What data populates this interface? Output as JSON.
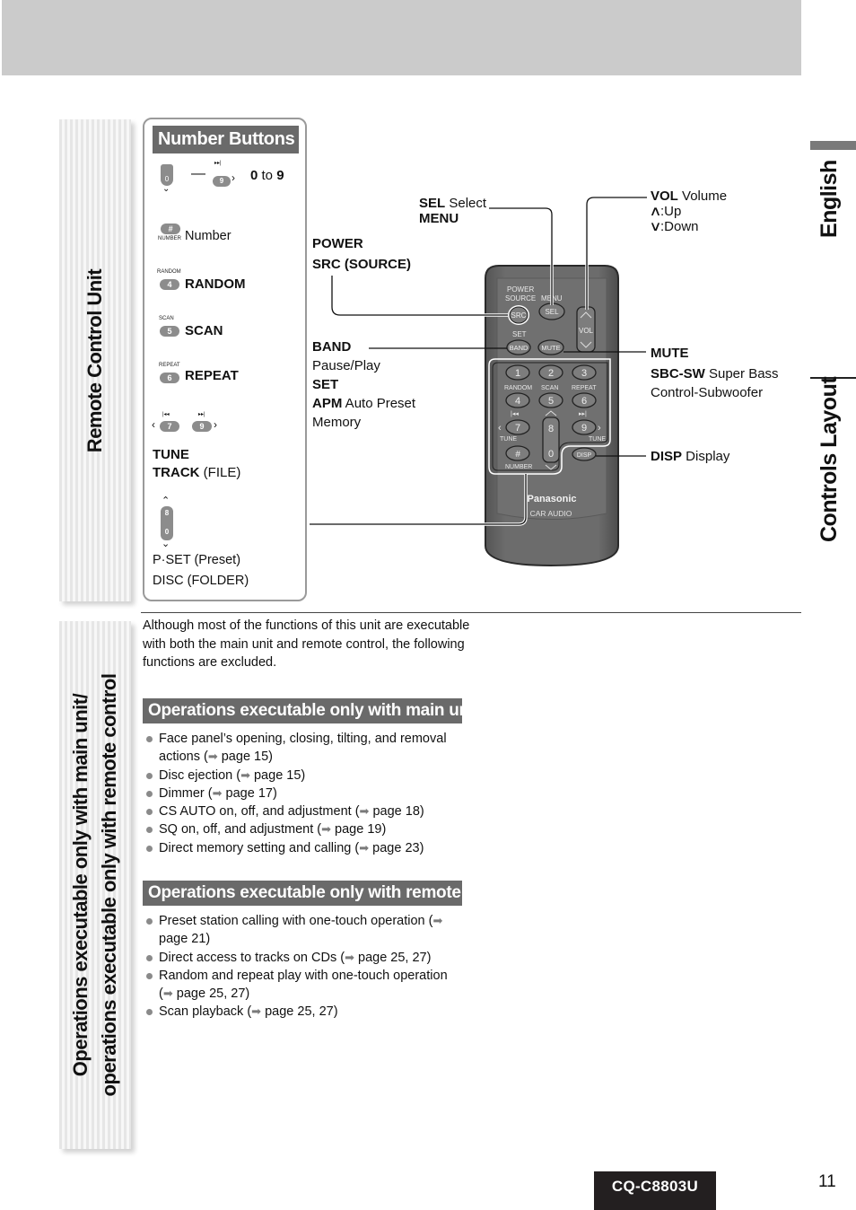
{
  "side_tabs": {
    "remote_control": "Remote Control Unit",
    "operations_line1": "Operations executable only with main unit/",
    "operations_line2": "operations executable only with remote control"
  },
  "right_tab": {
    "language": "English",
    "section": "Controls Layout"
  },
  "number_buttons": {
    "title": "Number Buttons",
    "rows": [
      {
        "button": "0 – 9",
        "label_bold": "0",
        "label_mid": " to ",
        "label_bold2": "9"
      },
      {
        "button": "#",
        "sublabel": "NUMBER",
        "label": "Number"
      },
      {
        "button": "4",
        "sublabel": "RANDOM",
        "label": "RANDOM"
      },
      {
        "button": "5",
        "sublabel": "SCAN",
        "label": "SCAN"
      },
      {
        "button": "6",
        "sublabel": "REPEAT",
        "label": "REPEAT"
      },
      {
        "buttons": [
          "7",
          "9"
        ],
        "label1": "TUNE",
        "label2_bold": "TRACK",
        "label2_rest": " (FILE)"
      },
      {
        "buttons": [
          "8",
          "0"
        ],
        "label1": "P·SET (Preset)",
        "label2": "DISC (FOLDER)"
      }
    ]
  },
  "callouts": {
    "sel": {
      "bold": "SEL",
      "rest": " Select",
      "line2": "MENU"
    },
    "power": {
      "line1": "POWER",
      "line2": "SRC (SOURCE)"
    },
    "band": {
      "bold": "BAND",
      "line2": "Pause/Play",
      "line3": "SET",
      "line4_bold": "APM",
      "line4_rest": " Auto Preset",
      "line5": "Memory"
    },
    "vol": {
      "bold": "VOL",
      "rest": " Volume",
      "up": ":Up",
      "down": ":Down"
    },
    "mute": {
      "bold": "MUTE",
      "line2_bold": "SBC-SW",
      "line2_rest": " Super Bass",
      "line3": "Control-Subwoofer"
    },
    "disp": {
      "bold": "DISP",
      "rest": " Display"
    }
  },
  "remote": {
    "labels": {
      "power": "POWER",
      "source": "SOURCE",
      "menu": "MENU",
      "src": "SRC",
      "sel": "SEL",
      "vol": "VOL",
      "set": "SET",
      "band": "BAND",
      "mute": "MUTE",
      "random": "RANDOM",
      "scan": "SCAN",
      "repeat": "REPEAT",
      "tune_left": "TUNE",
      "tune_right": "TUNE",
      "number": "NUMBER",
      "disp": "DISP",
      "brand": "Panasonic",
      "sub_brand": "CAR AUDIO"
    },
    "keys": [
      "1",
      "2",
      "3",
      "4",
      "5",
      "6",
      "7",
      "9",
      "#",
      "8",
      "0"
    ]
  },
  "intro": "Although most of the functions of this unit are executable with both the main unit and remote control, the following functions are excluded.",
  "main_unit_section": {
    "title": "Operations executable only with main unit",
    "items": [
      {
        "text": "Face panel’s opening, closing, tilting, and removal actions (",
        "ref": " page 15)"
      },
      {
        "text": "Disc ejection (",
        "ref": " page 15)"
      },
      {
        "text": "Dimmer (",
        "ref": " page 17)"
      },
      {
        "text": "CS AUTO on, off, and adjustment (",
        "ref": " page 18)"
      },
      {
        "text": "SQ on, off, and adjustment (",
        "ref": " page 19)"
      },
      {
        "text": "Direct memory setting and calling (",
        "ref": " page 23)"
      }
    ]
  },
  "remote_section": {
    "title": "Operations executable only with remote control",
    "items": [
      {
        "text": "Preset station calling with one-touch operation (",
        "ref": " page 21)"
      },
      {
        "text": "Direct access to tracks on CDs (",
        "ref": " page 25, 27)"
      },
      {
        "text": "Random and repeat play with one-touch operation (",
        "ref": " page 25, 27)"
      },
      {
        "text": "Scan playback (",
        "ref": " page 25, 27)"
      }
    ]
  },
  "footer": {
    "model": "CQ-C8803U",
    "page": "11"
  },
  "icons": {
    "arrow": "➡",
    "up": "⋀",
    "down": "⋁"
  }
}
